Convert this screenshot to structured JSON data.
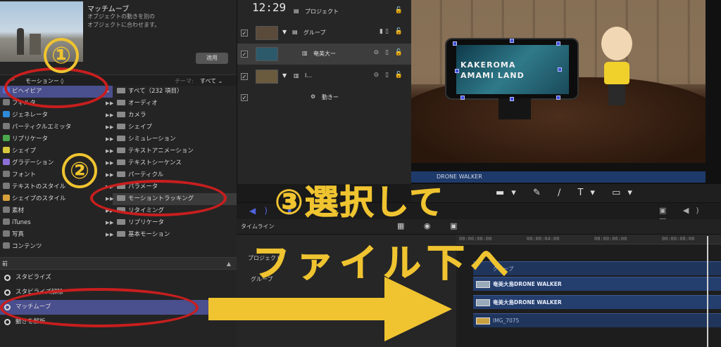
{
  "browser": {
    "effect_title": "マッチムーブ",
    "effect_desc_1": "オブジェクトの動きを別の",
    "effect_desc_2": "オブジェクトに合わせます。",
    "apply_label": "適用",
    "category_select": "モーションー ◊",
    "theme_label": "テーマ:",
    "theme_value": "すべて ⌄",
    "categories": [
      {
        "label": "ビヘイビア",
        "color": "#4f6fd8"
      },
      {
        "label": "フィルタ",
        "color": "#8a8a8a"
      },
      {
        "label": "ジェネレータ",
        "color": "#2e8bd8"
      },
      {
        "label": "パーティクルエミッタ",
        "color": "#8a8a8a"
      },
      {
        "label": "リプリケータ",
        "color": "#4ba84b"
      },
      {
        "label": "シェイプ",
        "color": "#d8c83a"
      },
      {
        "label": "グラデーション",
        "color": "#8d6fd8"
      },
      {
        "label": "フォント",
        "color": "#8a8a8a"
      },
      {
        "label": "テキストのスタイル",
        "color": "#8a8a8a"
      },
      {
        "label": "シェイプのスタイル",
        "color": "#d8a03a"
      },
      {
        "label": "素材",
        "color": "#8a8a8a"
      },
      {
        "label": "iTunes",
        "color": "#8a8a8a"
      },
      {
        "label": "写真",
        "color": "#8a8a8a"
      },
      {
        "label": "コンテンツ",
        "color": "#8a8a8a"
      }
    ],
    "subcategories": [
      "すべて（232 項目）",
      "オーディオ",
      "カメラ",
      "シェイプ",
      "シミュレーション",
      "テキストアニメーション",
      "テキストシーケンス",
      "パーティクル",
      "パラメータ",
      "モーショントラッキング",
      "リタイミング",
      "リプリケータ",
      "基本モーション"
    ],
    "section_header": "前",
    "behaviors": [
      "スタビライズ",
      "スタビライズ解除",
      "マッチムーブ",
      "動きを解析"
    ]
  },
  "annotations": {
    "step1": "①",
    "step2": "②",
    "caption_line1": "③選択して",
    "caption_line2": "ファイル下へ"
  },
  "layers": {
    "project": "プロジェクト",
    "group": "グループ",
    "rows": [
      "奄美大ー",
      "I...",
      "動きー"
    ]
  },
  "viewer": {
    "phone_text_1": "KAKEROMA",
    "phone_text_2": "AMAMI LAND",
    "title_strip": "DRONE WALKER"
  },
  "transport": {
    "timecode": "12:29"
  },
  "timeline": {
    "label": "タイムライン",
    "project": "プロジェクト",
    "group": "グループ",
    "ruler": [
      "00:00:00:00",
      "00:00:04:00",
      "00:00:06:00",
      "00:00:08:00"
    ],
    "group_track": "グループ",
    "tracks": [
      "奄美大島DRONE WALKER",
      "奄美大島DRONE WALKER",
      "IMG_7075"
    ]
  },
  "colors": {
    "accent_yellow": "#f0c430",
    "selection_blue": "#4a4f8e",
    "annotation_red": "#c81e1e"
  }
}
